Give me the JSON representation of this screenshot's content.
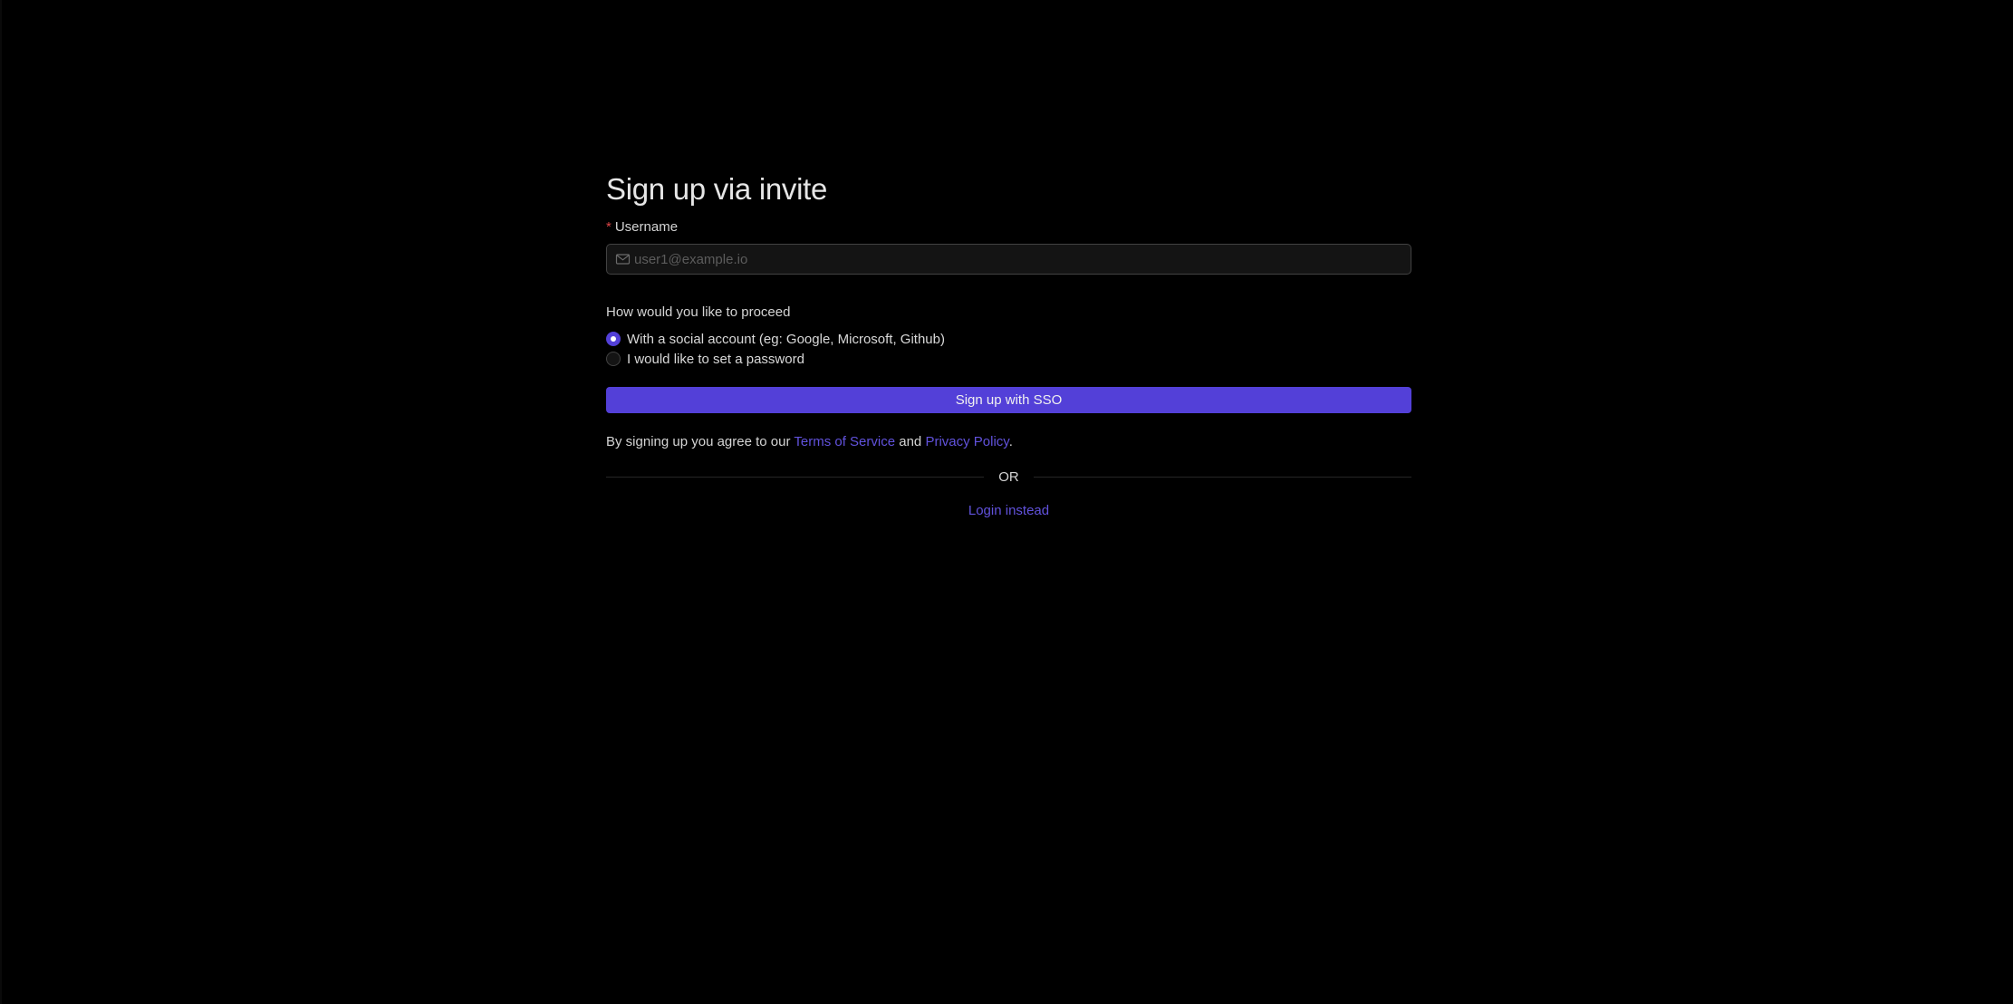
{
  "page": {
    "title": "Sign up via invite"
  },
  "username": {
    "required_mark": "*",
    "label": "Username",
    "placeholder": "user1@example.io",
    "value": "",
    "icon": "mail-icon"
  },
  "proceed": {
    "question": "How would you like to proceed",
    "options": [
      {
        "label": "With a social account (eg: Google, Microsoft, Github)",
        "selected": true
      },
      {
        "label": "I would like to set a password",
        "selected": false
      }
    ]
  },
  "actions": {
    "sso_button_label": "Sign up with SSO"
  },
  "legal": {
    "prefix": "By signing up you agree to our ",
    "terms_link": "Terms of Service",
    "conjunction": " and ",
    "privacy_link": "Privacy Policy",
    "suffix": "."
  },
  "divider": {
    "text": "OR"
  },
  "login": {
    "link_label": "Login instead"
  },
  "colors": {
    "background": "#000000",
    "accent": "#5340d8",
    "link": "#6152dc",
    "required": "#dc4446"
  }
}
